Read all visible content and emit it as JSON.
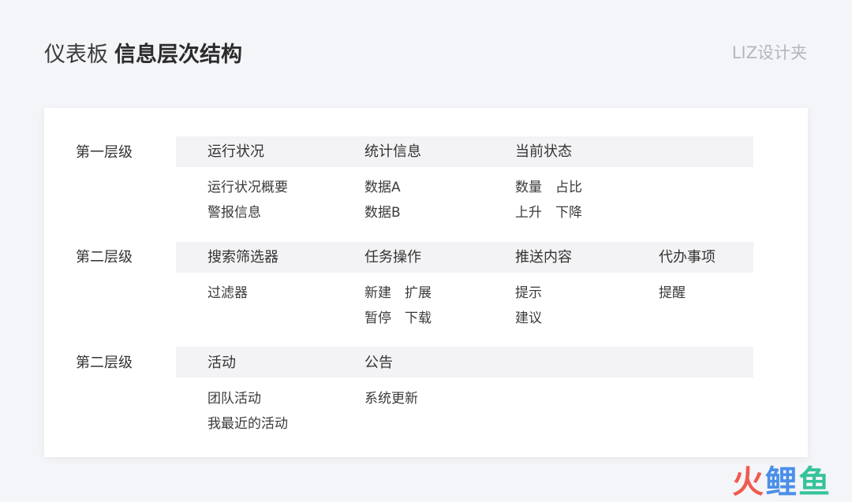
{
  "title": {
    "light": "仪表板",
    "bold": "信息层次结构"
  },
  "brand": "LIZ设计夹",
  "sections": [
    {
      "label": "第一层级",
      "headers": [
        "运行状况",
        "统计信息",
        "当前状态"
      ],
      "items": [
        [
          "运行状况概要",
          "警报信息"
        ],
        [
          "数据A",
          "数据B"
        ],
        [
          "数量　占比",
          "上升　下降"
        ]
      ]
    },
    {
      "label": "第二层级",
      "headers": [
        "搜索筛选器",
        "任务操作",
        "推送内容",
        "代办事项"
      ],
      "items": [
        [
          "过滤器"
        ],
        [
          "新建　扩展",
          "暂停　下载"
        ],
        [
          "提示",
          "建议"
        ],
        [
          "提醒"
        ]
      ]
    },
    {
      "label": "第二层级",
      "headers": [
        "活动",
        "公告"
      ],
      "items": [
        [
          "团队活动",
          "我最近的活动"
        ],
        [
          "系统更新"
        ]
      ]
    }
  ],
  "watermark": {
    "part1": "火",
    "part2": "鲤",
    "part3": "鱼"
  }
}
